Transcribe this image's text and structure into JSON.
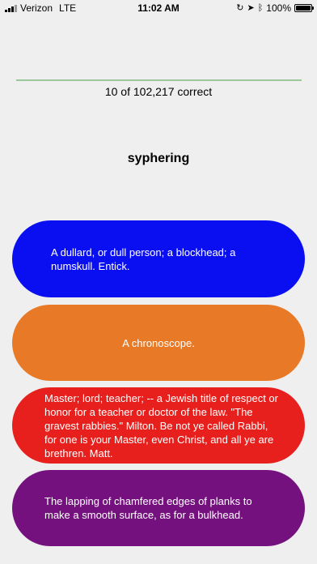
{
  "status_bar": {
    "carrier": "Verizon",
    "network": "LTE",
    "time": "11:02 AM",
    "battery_percent_text": "100%",
    "battery_level": 1.0,
    "icons": [
      "signal-bars-icon",
      "rotation-lock-icon",
      "location-arrow-icon",
      "bluetooth-icon",
      "battery-icon"
    ]
  },
  "progress": {
    "fraction": 1.0,
    "track_color": "#d2d2d2",
    "fill_color": "#9cc79c"
  },
  "score": {
    "text": "10 of 102,217 correct"
  },
  "word": {
    "text": "syphering"
  },
  "answers": [
    {
      "text": "A dullard, or dull person; a blockhead; a numskull. Entick.",
      "color": "#0a0ff2"
    },
    {
      "text": "A chronoscope.",
      "color": "#e87a27"
    },
    {
      "text": "Master; lord; teacher; -- a Jewish title of respect or honor for a teacher or doctor of the law. \"The gravest rabbies.\"  Milton. Be not ye called Rabbi, for one is your Master, even Christ, and all ye are brethren. Matt.",
      "color": "#e8201d"
    },
    {
      "text": "The lapping of chamfered edges of planks to make a smooth surface, as for a bulkhead.",
      "color": "#74117e"
    }
  ]
}
